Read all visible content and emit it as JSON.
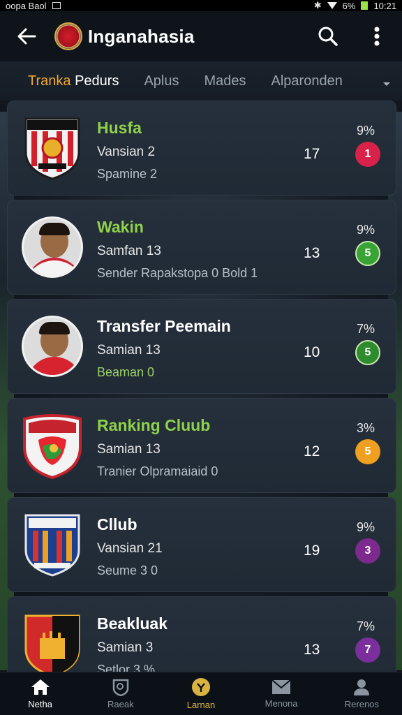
{
  "status_bar": {
    "left_text": "oopa Baol",
    "battery_text": "6%",
    "time": "10:21"
  },
  "app_bar": {
    "title": "Inganahasia"
  },
  "tabs": [
    {
      "label_accent": "Tranka",
      "label_rest": " Pedurs",
      "active": true
    },
    {
      "label": "Aplus"
    },
    {
      "label": "Mades"
    },
    {
      "label": "Alparonden"
    }
  ],
  "cards": [
    {
      "title": "Husfa",
      "title_green": true,
      "sub": "Vansian 2",
      "meta": "Spamine 2",
      "meta_green": false,
      "number": "17",
      "percent": "9%",
      "dot": "1",
      "dot_color": "#d9224a",
      "badge": "crest-red"
    },
    {
      "title": "Wakin",
      "title_green": true,
      "sub": "Samfan 13",
      "meta": "Sender Rapakstopa 0 Bold 1",
      "meta_green": false,
      "number": "13",
      "percent": "9%",
      "dot": "5",
      "dot_color": "#3aa335",
      "badge": "avatar-white"
    },
    {
      "title": "Transfer Peemain",
      "title_green": false,
      "sub": "Samian 13",
      "meta": "Beaman 0",
      "meta_green": true,
      "number": "10",
      "percent": "7%",
      "dot": "5",
      "dot_color": "#2e8b2e",
      "badge": "avatar-red"
    },
    {
      "title": "Ranking Cluub",
      "title_green": true,
      "sub": "Samian 13",
      "meta": "Tranier Olpramaiaid 0",
      "meta_green": false,
      "number": "12",
      "percent": "3%",
      "dot": "5",
      "dot_color": "#f0a020",
      "badge": "crest-green"
    },
    {
      "title": "Cllub",
      "title_green": false,
      "sub": "Vansian 21",
      "meta": "Seume 3 0",
      "meta_green": false,
      "number": "19",
      "percent": "9%",
      "dot": "3",
      "dot_color": "#7d2a8f",
      "badge": "crest-blue"
    },
    {
      "title": "Beakluak",
      "title_green": false,
      "sub": "Samian 3",
      "meta": "Setlor 3 %",
      "meta_green": false,
      "number": "13",
      "percent": "7%",
      "dot": "7",
      "dot_color": "#7a2f9c",
      "badge": "crest-orange"
    }
  ],
  "bottom_nav": [
    {
      "label": "Netha",
      "icon": "home-icon",
      "active": true
    },
    {
      "label": "Raeak",
      "icon": "search-shield-icon"
    },
    {
      "label": "Larnan",
      "icon": "trophy-icon",
      "gold": true
    },
    {
      "label": "Menona",
      "icon": "mail-icon"
    },
    {
      "label": "Rerenos",
      "icon": "profile-icon"
    }
  ]
}
